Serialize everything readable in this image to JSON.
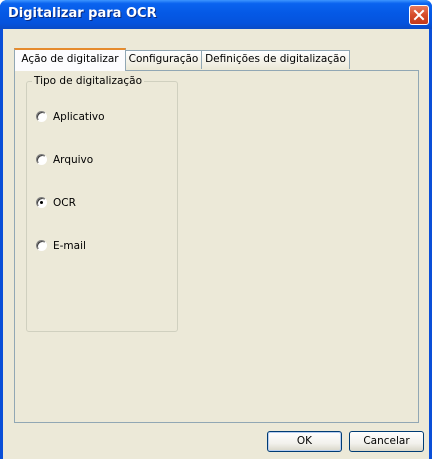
{
  "window": {
    "title": "Digitalizar para OCR",
    "close_icon": "close-icon"
  },
  "tabs": [
    {
      "label": "Ação de digitalizar",
      "active": true
    },
    {
      "label": "Configuração",
      "active": false
    },
    {
      "label": "Definições de digitalização",
      "active": false
    }
  ],
  "group": {
    "legend": "Tipo de digitalização",
    "options": [
      {
        "label": "Aplicativo",
        "selected": false
      },
      {
        "label": "Arquivo",
        "selected": false
      },
      {
        "label": "OCR",
        "selected": true
      },
      {
        "label": "E-mail",
        "selected": false
      }
    ]
  },
  "buttons": {
    "ok_label": "OK",
    "cancel_label": "Cancelar"
  },
  "colors": {
    "titlebar": "#0553dd",
    "face": "#ece9d8",
    "close": "#d64c2a",
    "active_tab_accent": "#e68b2c"
  }
}
